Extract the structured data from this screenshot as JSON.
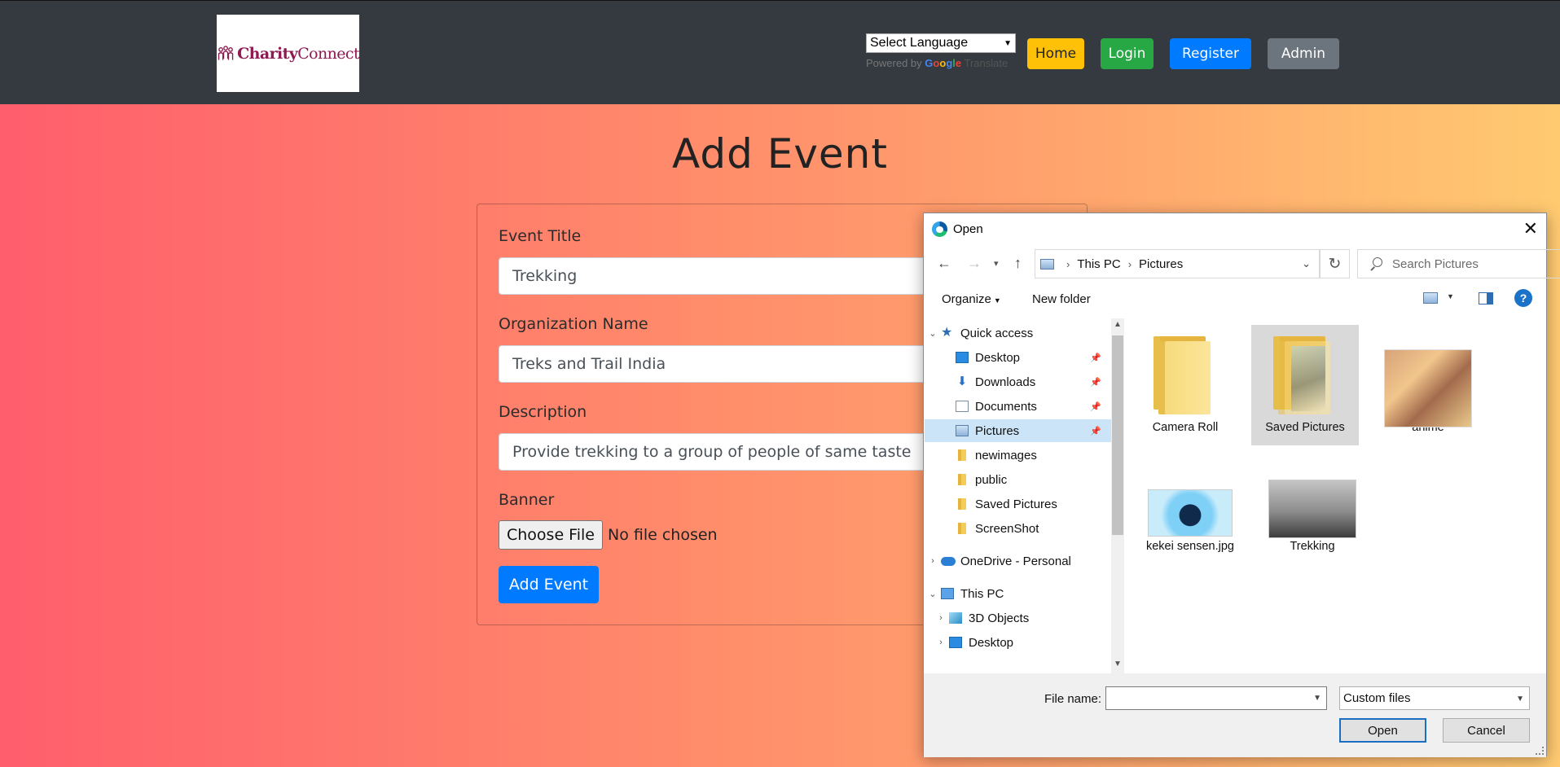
{
  "navbar": {
    "logo": {
      "text_bold": "Charity",
      "text_regular": "Connect"
    },
    "language": {
      "selected": "Select Language",
      "powered_by": "Powered by",
      "google": "Google",
      "translate": "Translate"
    },
    "buttons": {
      "home": "Home",
      "login": "Login",
      "register": "Register",
      "admin": "Admin"
    },
    "colors": {
      "home": "#ffc107",
      "login": "#28a745",
      "register": "#007bff",
      "admin": "#6c757d"
    }
  },
  "form": {
    "title": "Add Event",
    "event_title_label": "Event Title",
    "event_title_value": "Trekking",
    "org_label": "Organization Name",
    "org_value": "Treks and Trail India",
    "desc_label": "Description",
    "desc_value": "Provide trekking to a group of people of same taste",
    "banner_label": "Banner",
    "choose_file": "Choose File",
    "no_file": "No file chosen",
    "submit": "Add Event"
  },
  "dialog": {
    "title": "Open",
    "breadcrumb": [
      "This PC",
      "Pictures"
    ],
    "search_placeholder": "Search Pictures",
    "organize": "Organize",
    "new_folder": "New folder",
    "tree": [
      {
        "label": "Quick access",
        "icon": "star-icon"
      },
      {
        "label": "Desktop",
        "icon": "desktop-icon",
        "pinned": true
      },
      {
        "label": "Downloads",
        "icon": "download-icon",
        "pinned": true
      },
      {
        "label": "Documents",
        "icon": "documents-icon",
        "pinned": true
      },
      {
        "label": "Pictures",
        "icon": "pictures-icon",
        "pinned": true,
        "selected": true
      },
      {
        "label": "newimages",
        "icon": "folder-icon"
      },
      {
        "label": "public",
        "icon": "folder-icon"
      },
      {
        "label": "Saved Pictures",
        "icon": "folder-icon"
      },
      {
        "label": "ScreenShot",
        "icon": "folder-icon"
      },
      {
        "label": "OneDrive - Personal",
        "icon": "cloud-icon"
      },
      {
        "label": "This PC",
        "icon": "computer-icon"
      },
      {
        "label": "3D Objects",
        "icon": "cube-icon"
      },
      {
        "label": "Desktop",
        "icon": "desktop-icon"
      }
    ],
    "files": [
      {
        "name": "Camera Roll",
        "kind": "folder"
      },
      {
        "name": "Saved Pictures",
        "kind": "folder",
        "selected": true
      },
      {
        "name": "anime",
        "kind": "image"
      },
      {
        "name": "kekei sensen.jpg",
        "kind": "image"
      },
      {
        "name": "Trekking",
        "kind": "image"
      }
    ],
    "file_name_label": "File name:",
    "file_name_value": "",
    "filter": "Custom files",
    "open_button": "Open",
    "cancel_button": "Cancel"
  }
}
